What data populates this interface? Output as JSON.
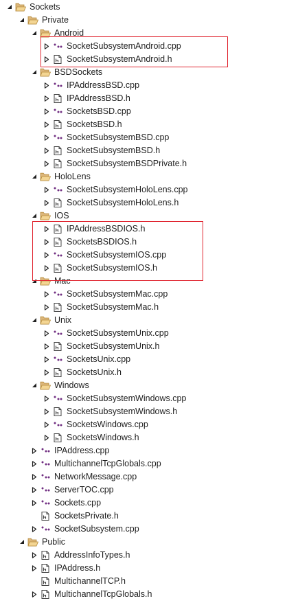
{
  "colors": {
    "folder": "#dcb67a",
    "folder_dark": "#b58b3c",
    "cpp_icon": "#68217a",
    "header_icon": "#424242",
    "arrow": "#1e1e1e",
    "highlight": "#e0242f"
  },
  "tree": [
    {
      "label": "Sockets",
      "icon": "folder-open-icon",
      "depth": 0,
      "arrow": "expanded"
    },
    {
      "label": "Private",
      "icon": "folder-open-icon",
      "depth": 1,
      "arrow": "expanded"
    },
    {
      "label": "Android",
      "icon": "folder-open-icon",
      "depth": 2,
      "arrow": "expanded"
    },
    {
      "label": "SocketSubsystemAndroid.cpp",
      "icon": "cpp-file-icon",
      "depth": 3,
      "arrow": "collapsed"
    },
    {
      "label": "SocketSubsystemAndroid.h",
      "icon": "header-file-icon",
      "depth": 3,
      "arrow": "collapsed"
    },
    {
      "label": "BSDSockets",
      "icon": "folder-open-icon",
      "depth": 2,
      "arrow": "expanded"
    },
    {
      "label": "IPAddressBSD.cpp",
      "icon": "cpp-file-icon",
      "depth": 3,
      "arrow": "collapsed"
    },
    {
      "label": "IPAddressBSD.h",
      "icon": "header-file-icon",
      "depth": 3,
      "arrow": "collapsed"
    },
    {
      "label": "SocketsBSD.cpp",
      "icon": "cpp-file-icon",
      "depth": 3,
      "arrow": "collapsed"
    },
    {
      "label": "SocketsBSD.h",
      "icon": "header-file-icon",
      "depth": 3,
      "arrow": "collapsed"
    },
    {
      "label": "SocketSubsystemBSD.cpp",
      "icon": "cpp-file-icon",
      "depth": 3,
      "arrow": "collapsed"
    },
    {
      "label": "SocketSubsystemBSD.h",
      "icon": "header-file-icon",
      "depth": 3,
      "arrow": "collapsed"
    },
    {
      "label": "SocketSubsystemBSDPrivate.h",
      "icon": "header-file-icon",
      "depth": 3,
      "arrow": "collapsed"
    },
    {
      "label": "HoloLens",
      "icon": "folder-open-icon",
      "depth": 2,
      "arrow": "expanded"
    },
    {
      "label": "SocketSubsystemHoloLens.cpp",
      "icon": "cpp-file-icon",
      "depth": 3,
      "arrow": "collapsed"
    },
    {
      "label": "SocketSubsystemHoloLens.h",
      "icon": "header-file-icon",
      "depth": 3,
      "arrow": "collapsed"
    },
    {
      "label": "IOS",
      "icon": "folder-open-icon",
      "depth": 2,
      "arrow": "expanded"
    },
    {
      "label": "IPAddressBSDIOS.h",
      "icon": "header-file-icon",
      "depth": 3,
      "arrow": "collapsed"
    },
    {
      "label": "SocketsBSDIOS.h",
      "icon": "header-file-icon",
      "depth": 3,
      "arrow": "collapsed"
    },
    {
      "label": "SocketSubsystemIOS.cpp",
      "icon": "cpp-file-icon",
      "depth": 3,
      "arrow": "collapsed"
    },
    {
      "label": "SocketSubsystemIOS.h",
      "icon": "header-file-icon",
      "depth": 3,
      "arrow": "collapsed"
    },
    {
      "label": "Mac",
      "icon": "folder-open-icon",
      "depth": 2,
      "arrow": "expanded"
    },
    {
      "label": "SocketSubsystemMac.cpp",
      "icon": "cpp-file-icon",
      "depth": 3,
      "arrow": "collapsed"
    },
    {
      "label": "SocketSubsystemMac.h",
      "icon": "header-file-icon",
      "depth": 3,
      "arrow": "collapsed"
    },
    {
      "label": "Unix",
      "icon": "folder-open-icon",
      "depth": 2,
      "arrow": "expanded"
    },
    {
      "label": "SocketSubsystemUnix.cpp",
      "icon": "cpp-file-icon",
      "depth": 3,
      "arrow": "collapsed"
    },
    {
      "label": "SocketSubsystemUnix.h",
      "icon": "header-file-icon",
      "depth": 3,
      "arrow": "collapsed"
    },
    {
      "label": "SocketsUnix.cpp",
      "icon": "cpp-file-icon",
      "depth": 3,
      "arrow": "collapsed"
    },
    {
      "label": "SocketsUnix.h",
      "icon": "header-file-icon",
      "depth": 3,
      "arrow": "collapsed"
    },
    {
      "label": "Windows",
      "icon": "folder-open-icon",
      "depth": 2,
      "arrow": "expanded"
    },
    {
      "label": "SocketSubsystemWindows.cpp",
      "icon": "cpp-file-icon",
      "depth": 3,
      "arrow": "collapsed"
    },
    {
      "label": "SocketSubsystemWindows.h",
      "icon": "header-file-icon",
      "depth": 3,
      "arrow": "collapsed"
    },
    {
      "label": "SocketsWindows.cpp",
      "icon": "cpp-file-icon",
      "depth": 3,
      "arrow": "collapsed"
    },
    {
      "label": "SocketsWindows.h",
      "icon": "header-file-icon",
      "depth": 3,
      "arrow": "collapsed"
    },
    {
      "label": "IPAddress.cpp",
      "icon": "cpp-file-icon",
      "depth": 2,
      "arrow": "collapsed"
    },
    {
      "label": "MultichannelTcpGlobals.cpp",
      "icon": "cpp-file-icon",
      "depth": 2,
      "arrow": "collapsed"
    },
    {
      "label": "NetworkMessage.cpp",
      "icon": "cpp-file-icon",
      "depth": 2,
      "arrow": "collapsed"
    },
    {
      "label": "ServerTOC.cpp",
      "icon": "cpp-file-icon",
      "depth": 2,
      "arrow": "collapsed"
    },
    {
      "label": "Sockets.cpp",
      "icon": "cpp-file-icon",
      "depth": 2,
      "arrow": "collapsed"
    },
    {
      "label": "SocketsPrivate.h",
      "icon": "header-file-icon",
      "depth": 2,
      "arrow": "none"
    },
    {
      "label": "SocketSubsystem.cpp",
      "icon": "cpp-file-icon",
      "depth": 2,
      "arrow": "collapsed"
    },
    {
      "label": "Public",
      "icon": "folder-open-icon",
      "depth": 1,
      "arrow": "expanded"
    },
    {
      "label": "AddressInfoTypes.h",
      "icon": "header-file-icon",
      "depth": 2,
      "arrow": "collapsed"
    },
    {
      "label": "IPAddress.h",
      "icon": "header-file-icon",
      "depth": 2,
      "arrow": "collapsed"
    },
    {
      "label": "MultichannelTCP.h",
      "icon": "header-file-icon",
      "depth": 2,
      "arrow": "none"
    },
    {
      "label": "MultichannelTcpGlobals.h",
      "icon": "header-file-icon",
      "depth": 2,
      "arrow": "collapsed"
    }
  ]
}
